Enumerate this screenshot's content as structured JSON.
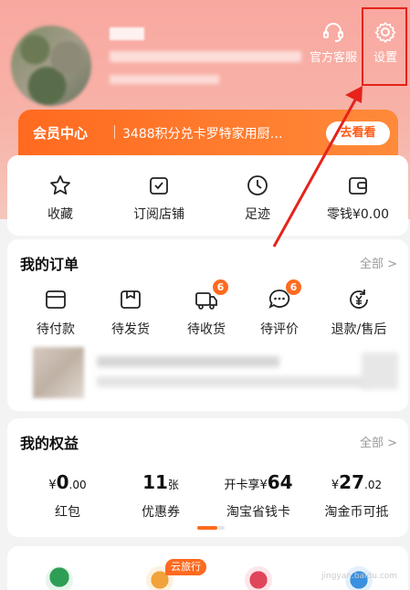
{
  "header": {
    "service_label": "官方客服",
    "settings_label": "设置"
  },
  "member": {
    "title": "会员中心",
    "desc": "3488积分兑卡罗特家用厨…",
    "button": "去看看"
  },
  "quick_actions": [
    {
      "label": "收藏"
    },
    {
      "label": "订阅店铺"
    },
    {
      "label": "足迹"
    },
    {
      "label": "零钱¥0.00"
    }
  ],
  "orders": {
    "title": "我的订单",
    "more": "全部 >",
    "items": [
      {
        "label": "待付款",
        "badge": ""
      },
      {
        "label": "待发货",
        "badge": ""
      },
      {
        "label": "待收货",
        "badge": "6"
      },
      {
        "label": "待评价",
        "badge": "6"
      },
      {
        "label": "退款/售后",
        "badge": ""
      }
    ]
  },
  "benefits": {
    "title": "我的权益",
    "more": "全部 >",
    "items": [
      {
        "prefix": "¥",
        "value": "0",
        "suffix": ".00",
        "label": "红包"
      },
      {
        "prefix": "",
        "value": "11",
        "suffix": "张",
        "label": "优惠券"
      },
      {
        "prefix": "开卡享¥",
        "value": "64",
        "suffix": "",
        "label": "淘宝省钱卡"
      },
      {
        "prefix": "¥",
        "value": "27",
        "suffix": ".02",
        "label": "淘金币可抵"
      }
    ]
  },
  "bottom": {
    "travel_tag": "云旅行"
  },
  "watermark": {
    "main": "Bai 经验",
    "sub": "jingyan.baidu.com"
  },
  "colors": {
    "accent": "#ff6a1f",
    "annotation": "#e5231b"
  }
}
